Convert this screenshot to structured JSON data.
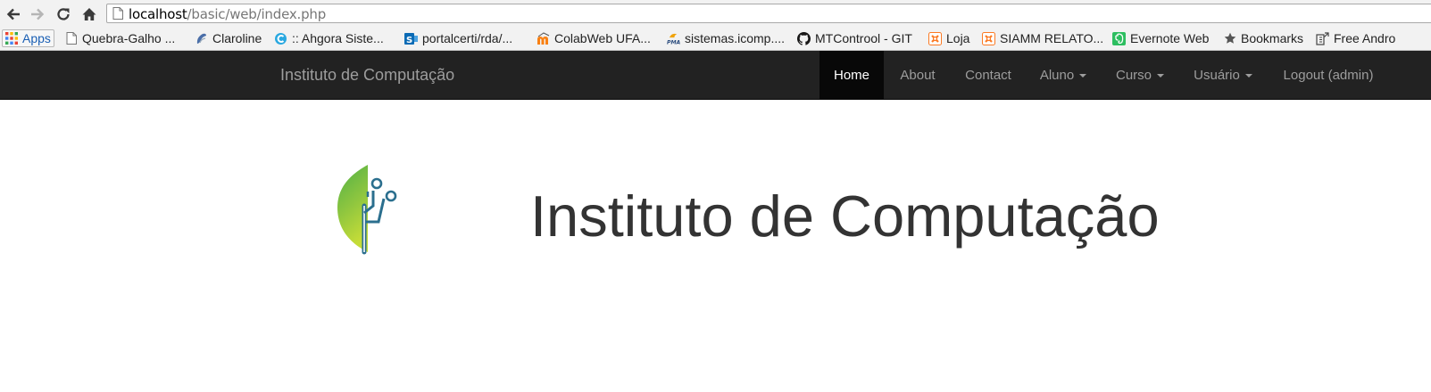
{
  "browser": {
    "url_host": "localhost",
    "url_path": "/basic/web/index.php",
    "bookmarks": [
      {
        "label": "Apps",
        "icon": "apps-grid-icon"
      },
      {
        "label": "Quebra-Galho ...",
        "icon": "page-icon"
      },
      {
        "label": "Claroline",
        "icon": "claroline-icon"
      },
      {
        "label": ":: Ahgora Siste...",
        "icon": "ahgora-icon"
      },
      {
        "label": "portalcerti/rda/...",
        "icon": "sharepoint-icon"
      },
      {
        "label": "ColabWeb UFA...",
        "icon": "moodle-icon"
      },
      {
        "label": "sistemas.icomp....",
        "icon": "pma-icon"
      },
      {
        "label": "MTControol - GIT",
        "icon": "github-icon"
      },
      {
        "label": "Loja",
        "icon": "xampp-icon"
      },
      {
        "label": "SIAMM RELATO...",
        "icon": "xampp-icon"
      },
      {
        "label": "Evernote Web",
        "icon": "evernote-icon"
      },
      {
        "label": "Bookmarks",
        "icon": "star-icon"
      },
      {
        "label": "Free Andro",
        "icon": "bookmark-site-icon"
      }
    ]
  },
  "navbar": {
    "brand": "Instituto de Computação",
    "items": [
      {
        "label": "Home",
        "active": true
      },
      {
        "label": "About"
      },
      {
        "label": "Contact"
      },
      {
        "label": "Aluno",
        "dropdown": true
      },
      {
        "label": "Curso",
        "dropdown": true
      },
      {
        "label": "Usuário",
        "dropdown": true
      },
      {
        "label": "Logout (admin)"
      }
    ]
  },
  "main": {
    "title": "Instituto de Computação",
    "logo_icon": "leaf-circuit-logo"
  },
  "colors": {
    "navbar_bg": "#222222",
    "navbar_text": "#9d9d9d",
    "navbar_active_bg": "#080808",
    "logo_green": "#5bb543",
    "logo_lime": "#b3d335",
    "logo_blue": "#2b6f8e"
  }
}
